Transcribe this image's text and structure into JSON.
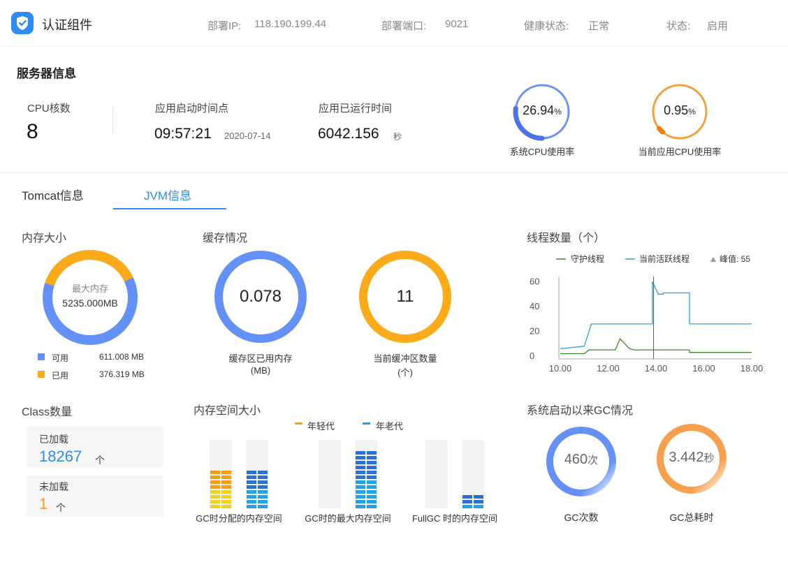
{
  "header": {
    "app_name": "认证组件",
    "fields": [
      {
        "label": "部署IP:",
        "value": "118.190.199.44"
      },
      {
        "label": "部署端口:",
        "value": "9021"
      },
      {
        "label": "健康状态:",
        "value": "正常"
      },
      {
        "label": "状态:",
        "value": "启用"
      }
    ]
  },
  "server": {
    "title": "服务器信息",
    "cpu_cores_label": "CPU核数",
    "cpu_cores": "8",
    "start_time_label": "应用启动时间点",
    "start_time": "09:57:21",
    "start_date": "2020-07-14",
    "uptime_label": "应用已运行时间",
    "uptime": "6042.156",
    "uptime_unit": "秒",
    "sys_cpu": {
      "value": "26.94",
      "unit": "%",
      "label": "系统CPU使用率",
      "fraction": 0.2694
    },
    "app_cpu": {
      "value": "0.95",
      "unit": "%",
      "label": "当前应用CPU使用率",
      "fraction": 0.0095
    }
  },
  "tabs": [
    {
      "label": "Tomcat信息",
      "active": false
    },
    {
      "label": "JVM信息",
      "active": true
    }
  ],
  "memory": {
    "title": "内存大小",
    "center_label": "最大内存",
    "center_value": "5235.000MB",
    "legend": [
      {
        "label": "可用",
        "value": "611.008 MB",
        "color": "#6491f8"
      },
      {
        "label": "已用",
        "value": "376.319 MB",
        "color": "#fbab1a"
      }
    ],
    "used_fraction": 0.381
  },
  "cache": {
    "title": "缓存情况",
    "used": {
      "value": "0.078",
      "label_line1": "缓存区已用内存",
      "label_line2": "(MB)",
      "color": "#6491f8"
    },
    "count": {
      "value": "11",
      "label_line1": "当前缓冲区数量",
      "label_line2": "(个)",
      "color": "#fbab1a"
    }
  },
  "threads": {
    "title": "线程数量（个）",
    "legend_daemon": "守护线程",
    "legend_active": "当前活跃线程",
    "legend_peak": "峰值: 55",
    "chart_data": {
      "type": "line",
      "x_ticks": [
        "10.00",
        "12.00",
        "14.00",
        "16.00",
        "18.00"
      ],
      "y_ticks": [
        "0",
        "20",
        "40",
        "60"
      ],
      "xlim": [
        10.0,
        18.0
      ],
      "ylim": [
        0,
        62
      ],
      "series": [
        {
          "name": "当前活跃线程",
          "color": "#2d9ce6",
          "points": [
            [
              10.0,
              6
            ],
            [
              11.0,
              8
            ],
            [
              11.3,
              26
            ],
            [
              13.5,
              26
            ],
            [
              13.85,
              26
            ],
            [
              13.85,
              60
            ],
            [
              14.1,
              50
            ],
            [
              14.3,
              50
            ],
            [
              14.3,
              51
            ],
            [
              15.4,
              51
            ],
            [
              15.4,
              26
            ],
            [
              18.0,
              26
            ]
          ]
        },
        {
          "name": "守护线程",
          "color": "#3a8a2a",
          "points": [
            [
              10.0,
              2
            ],
            [
              11.0,
              2
            ],
            [
              11.2,
              5
            ],
            [
              12.2,
              5
            ],
            [
              12.3,
              5
            ],
            [
              12.5,
              14
            ],
            [
              12.9,
              6
            ],
            [
              13.1,
              5
            ],
            [
              15.4,
              5
            ],
            [
              15.4,
              3
            ],
            [
              18.0,
              3
            ]
          ]
        }
      ],
      "marker_x": 13.9
    }
  },
  "classes": {
    "title": "Class数量",
    "loaded_label": "已加载",
    "loaded_value": "18267",
    "loaded_unit": "个",
    "unloaded_label": "未加载",
    "unloaded_value": "1",
    "unloaded_unit": "个"
  },
  "mem_space": {
    "title": "内存空间大小",
    "legend_young": "年轻代",
    "legend_old": "年老代",
    "groups": [
      {
        "label": "GC时分配的内存空间",
        "young_fraction": 0.6,
        "old_fraction": 0.6
      },
      {
        "label": "GC时的最大内存空间",
        "young_fraction": 0.0,
        "old_fraction": 0.92
      },
      {
        "label": "FullGC 时的内存空间",
        "young_fraction": 0.0,
        "old_fraction": 0.24
      }
    ]
  },
  "gc": {
    "title": "系统启动以来GC情况",
    "count": {
      "value": "460",
      "unit": "次",
      "label": "GC次数"
    },
    "time": {
      "value": "3.442",
      "unit": "秒",
      "label": "GC总耗时"
    }
  }
}
